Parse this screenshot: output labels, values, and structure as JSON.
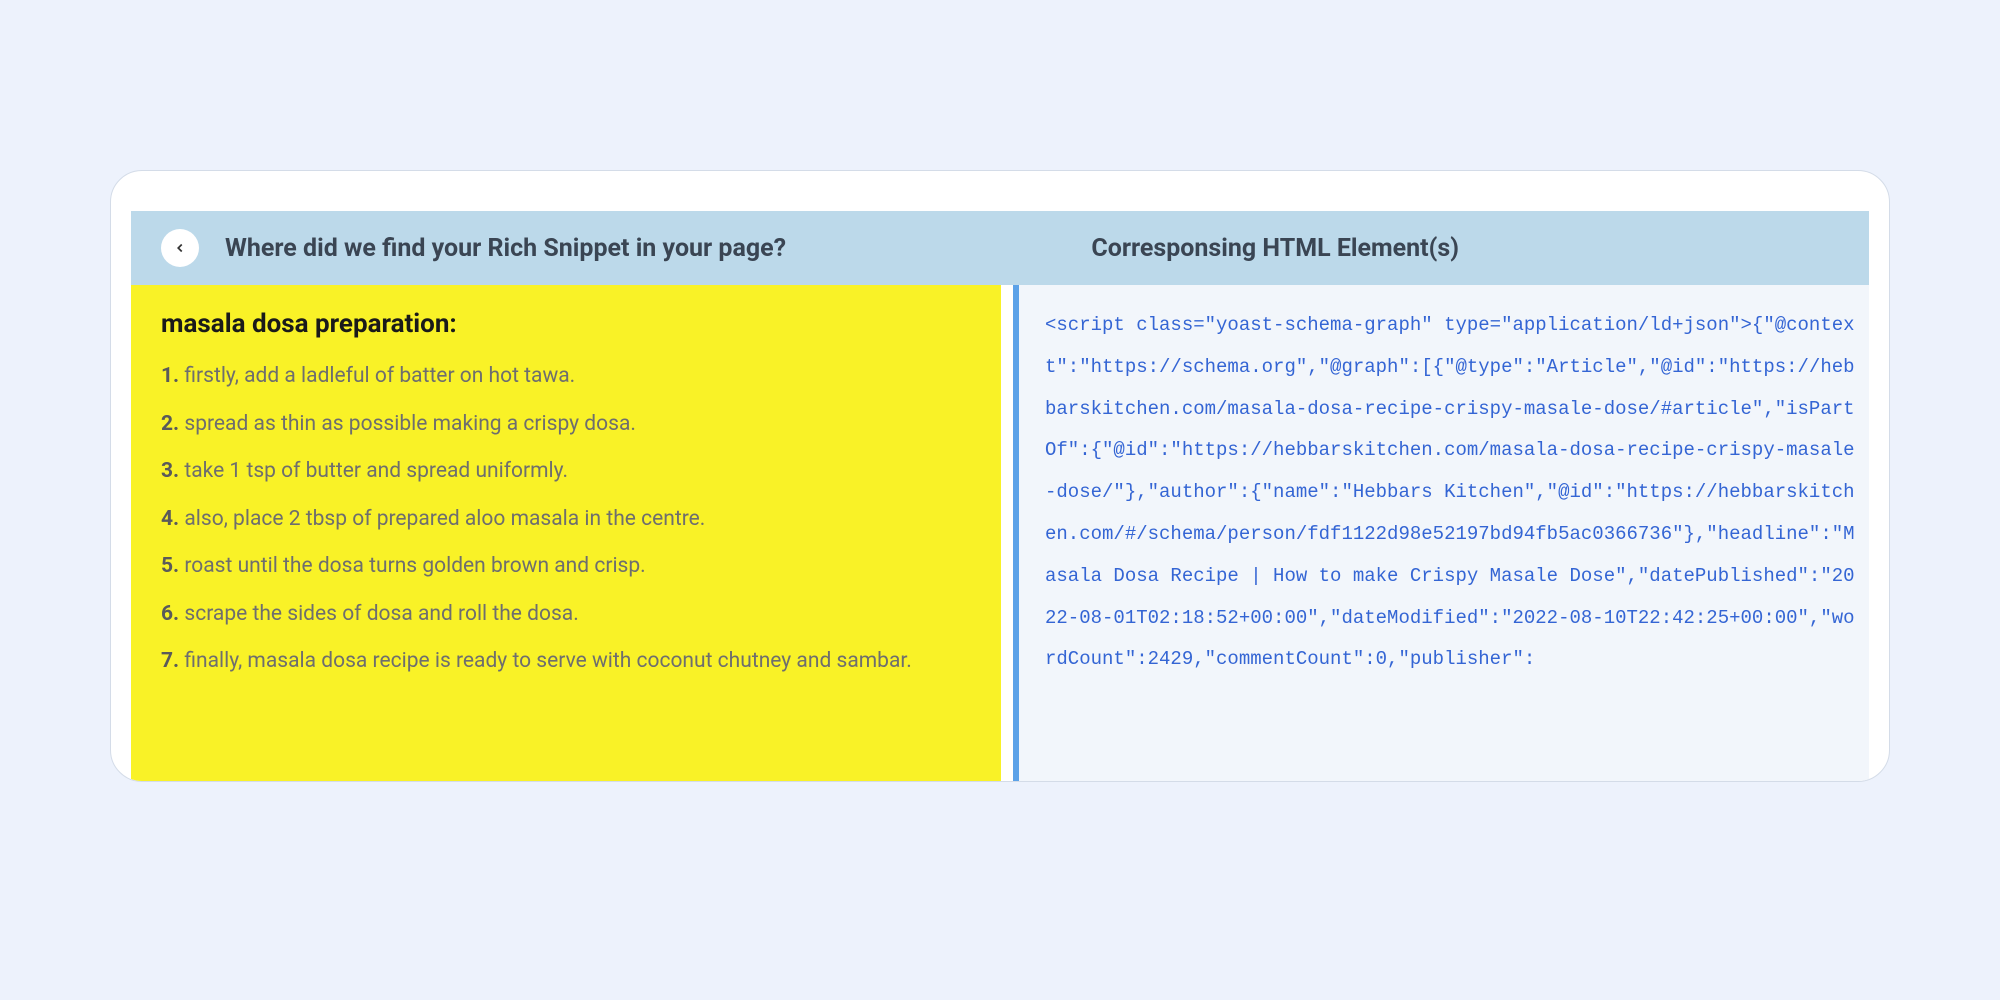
{
  "header": {
    "title_left": "Where did we find your Rich Snippet in your page?",
    "title_right": "Corresponsing HTML Element(s)"
  },
  "recipe": {
    "title": "masala dosa preparation:",
    "steps": [
      {
        "num": "1.",
        "text": "firstly, add a ladleful of batter on hot tawa."
      },
      {
        "num": "2.",
        "text": "spread as thin as possible making a crispy dosa."
      },
      {
        "num": "3.",
        "text": "take 1 tsp of butter and spread uniformly."
      },
      {
        "num": "4.",
        "text": "also, place 2 tbsp of prepared aloo masala in the centre."
      },
      {
        "num": "5.",
        "text": "roast until the dosa turns golden brown and crisp."
      },
      {
        "num": "6.",
        "text": "scrape the sides of dosa and roll the dosa."
      },
      {
        "num": "7.",
        "text": "finally, masala dosa recipe is ready to serve with coconut chutney and sambar."
      }
    ]
  },
  "code": "<script class=\"yoast-schema-graph\" type=\"application/ld+json\">{\"@context\":\"https://schema.org\",\"@graph\":[{\"@type\":\"Article\",\"@id\":\"https://hebbarskitchen.com/masala-dosa-recipe-crispy-masale-dose/#article\",\"isPartOf\":{\"@id\":\"https://hebbarskitchen.com/masala-dosa-recipe-crispy-masale-dose/\"},\"author\":{\"name\":\"Hebbars Kitchen\",\"@id\":\"https://hebbarskitchen.com/#/schema/person/fdf1122d98e52197bd94fb5ac0366736\"},\"headline\":\"Masala Dosa Recipe | How to make Crispy Masale Dose\",\"datePublished\":\"2022-08-01T02:18:52+00:00\",\"dateModified\":\"2022-08-10T22:42:25+00:00\",\"wordCount\":2429,\"commentCount\":0,\"publisher\":\n\n\n\n\n"
}
